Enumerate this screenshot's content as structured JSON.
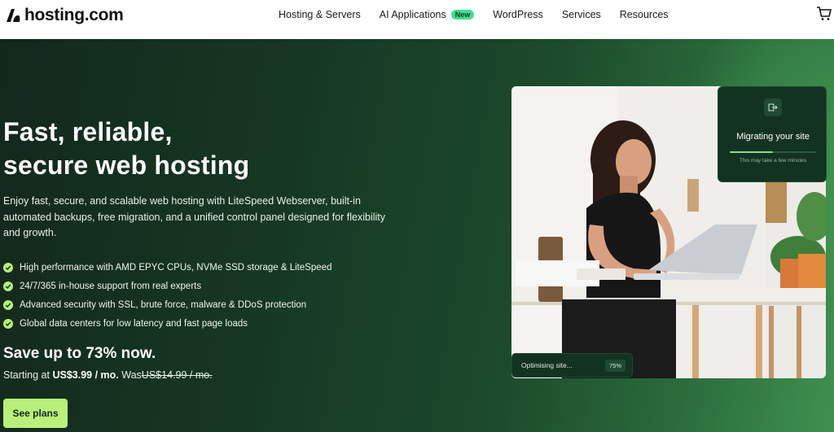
{
  "brand": {
    "name": "hosting.com",
    "accent": "#b8f07a",
    "badge_color": "#3ee08f"
  },
  "nav": {
    "items": [
      {
        "label": "Hosting & Servers"
      },
      {
        "label": "AI Applications",
        "badge": "New"
      },
      {
        "label": "WordPress"
      },
      {
        "label": "Services"
      },
      {
        "label": "Resources"
      }
    ],
    "cart_icon": "cart-icon"
  },
  "hero": {
    "headline_line1": "Fast, reliable,",
    "headline_line2": "secure web hosting",
    "description": "Enjoy fast, secure, and scalable web hosting with LiteSpeed Webserver, built-in automated backups, free migration, and a unified control panel designed for flexibility and growth.",
    "features": [
      "High performance with AMD EPYC CPUs, NVMe SSD storage & LiteSpeed",
      "24/7/365 in-house support from real experts",
      "Advanced security with SSL, brute force, malware & DDoS protection",
      "Global data centers for low latency and fast page loads"
    ],
    "save_text": "Save up to 73% now.",
    "price_prefix": "Starting at",
    "price_current": "US$3.99 / mo.",
    "price_was_label": "Was",
    "price_old": "US$14.99 / mo.",
    "cta_label": "See plans"
  },
  "migrate_card": {
    "icon": "migrate-icon",
    "title": "Migrating your site",
    "subtitle": "This may take a few minutes",
    "progress": 0.5
  },
  "optimise_card": {
    "label": "Optimising site...",
    "percent": "75%"
  }
}
